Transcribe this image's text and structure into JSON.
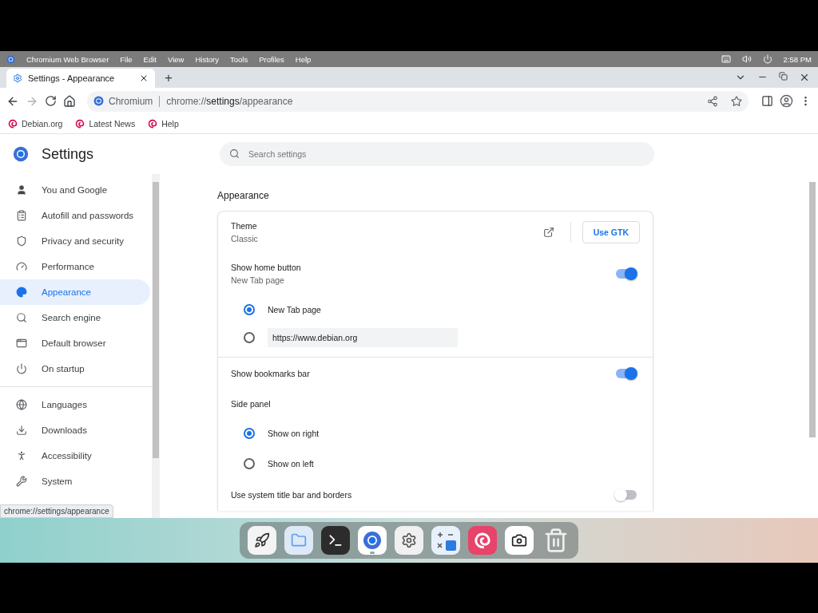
{
  "system_bar": {
    "app_name": "Chromium Web Browser",
    "menu": [
      "File",
      "Edit",
      "View",
      "History",
      "Tools",
      "Profiles",
      "Help"
    ],
    "clock": "2:58 PM"
  },
  "tabs": [
    {
      "title": "Settings - Appearance",
      "selected": true
    }
  ],
  "new_tab": "+",
  "toolbar": {
    "site_label": "Chromium",
    "url": "chrome://**settings**/appearance"
  },
  "bookmarks": [
    "Debian.org",
    "Latest News",
    "Help"
  ],
  "settings": {
    "title": "Settings",
    "search": {
      "placeholder": "Search settings"
    },
    "sidebar": [
      {
        "label": "You and Google",
        "selected": false
      },
      {
        "label": "Autofill and passwords",
        "selected": false
      },
      {
        "label": "Privacy and security",
        "selected": false
      },
      {
        "label": "Performance",
        "selected": false
      },
      {
        "label": "Appearance",
        "selected": true
      },
      {
        "label": "Search engine",
        "selected": false
      },
      {
        "label": "Default browser",
        "selected": false
      },
      {
        "label": "On startup",
        "selected": false
      },
      {
        "label": "Languages",
        "selected": false
      },
      {
        "label": "Downloads",
        "selected": false
      },
      {
        "label": "Accessibility",
        "selected": false
      },
      {
        "label": "System",
        "selected": false
      }
    ],
    "section_title": "Appearance",
    "rows": [
      {
        "kind": "theme",
        "label": "Theme",
        "sublabel": "Classic",
        "button": "Use GTK"
      },
      {
        "kind": "toggle",
        "label": "Show home button",
        "sublabel": "New Tab page",
        "on": true
      },
      {
        "kind": "radios",
        "options": [
          {
            "label": "New Tab page",
            "selected": true
          },
          {
            "value": "https://www.debian.org",
            "selected": false
          }
        ]
      },
      {
        "kind": "toggle",
        "label": "Show bookmarks bar",
        "on": true
      },
      {
        "kind": "heading",
        "label": "Side panel"
      },
      {
        "kind": "radios",
        "options": [
          {
            "label": "Show on right",
            "selected": true
          },
          {
            "label": "Show on left",
            "selected": false
          }
        ]
      },
      {
        "kind": "toggle",
        "label": "Use system title bar and borders",
        "on": false
      }
    ]
  },
  "status_bubble": "chrome://settings/appearance",
  "dock": [
    {
      "kind": "rocket",
      "running": false
    },
    {
      "kind": "folder",
      "running": false
    },
    {
      "kind": "terminal",
      "running": false
    },
    {
      "kind": "browser",
      "running": true
    },
    {
      "kind": "settings",
      "running": false
    },
    {
      "kind": "calculator",
      "running": false
    },
    {
      "kind": "debian",
      "running": false
    },
    {
      "kind": "screenshot",
      "running": false
    },
    {
      "kind": "trash",
      "running": false
    }
  ]
}
